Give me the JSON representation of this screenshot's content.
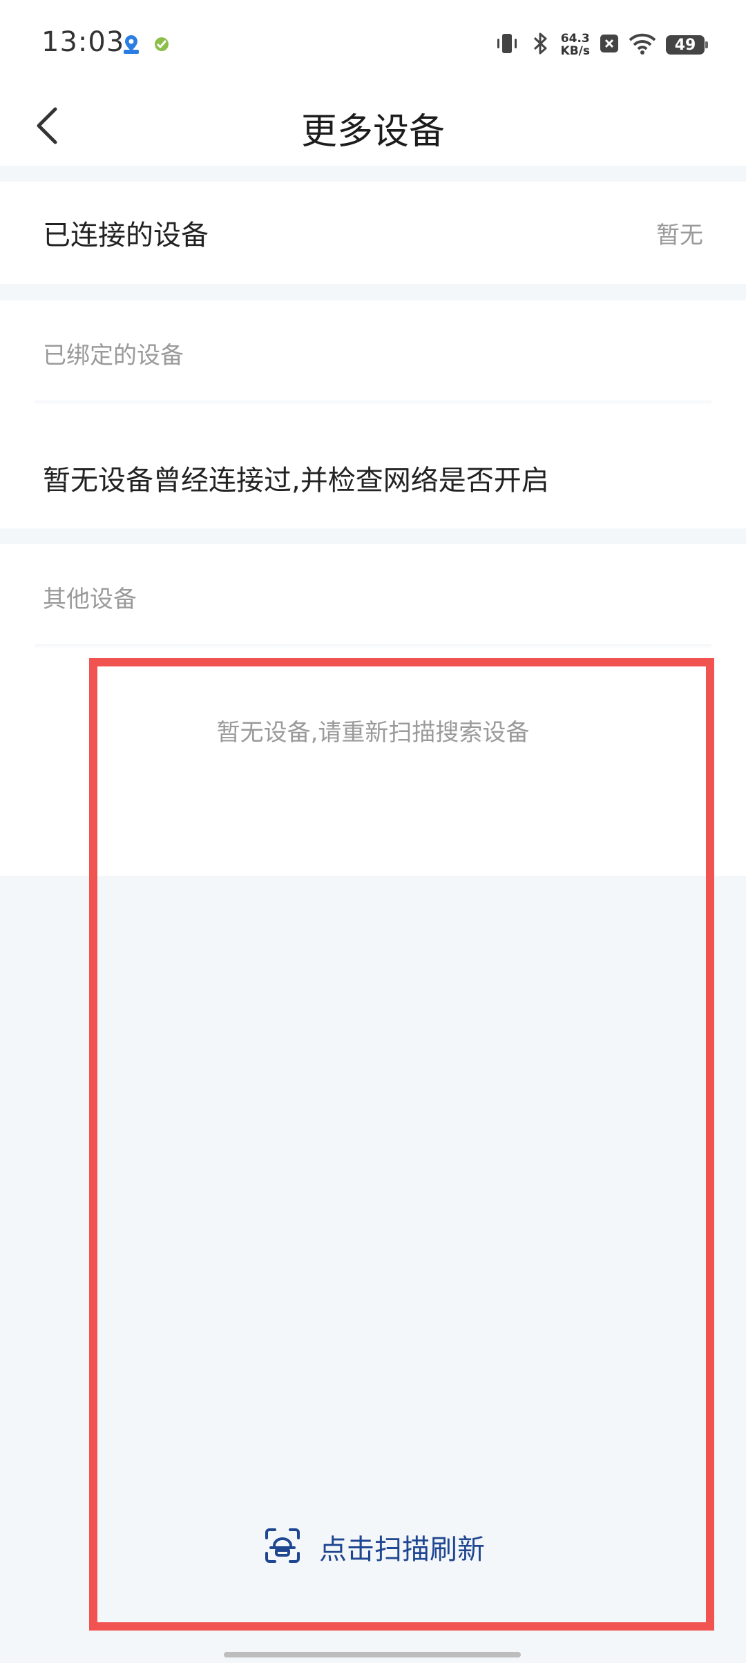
{
  "status_bar": {
    "time": "13:03",
    "net_speed_value": "64.3",
    "net_speed_unit": "KB/s",
    "battery_level": "49"
  },
  "header": {
    "title": "更多设备"
  },
  "connected": {
    "title": "已连接的设备",
    "value": "暂无"
  },
  "bound": {
    "label": "已绑定的设备",
    "empty_text": "暂无设备曾经连接过,并检查网络是否开启"
  },
  "other": {
    "label": "其他设备",
    "empty_text": "暂无设备,请重新扫描搜索设备"
  },
  "scan": {
    "label": "点击扫描刷新",
    "icon": "scan-refresh-icon"
  },
  "colors": {
    "accent": "#1f4690",
    "highlight": "#f05350",
    "background": "#f4f7fa",
    "muted_text": "#9a9a9a"
  }
}
